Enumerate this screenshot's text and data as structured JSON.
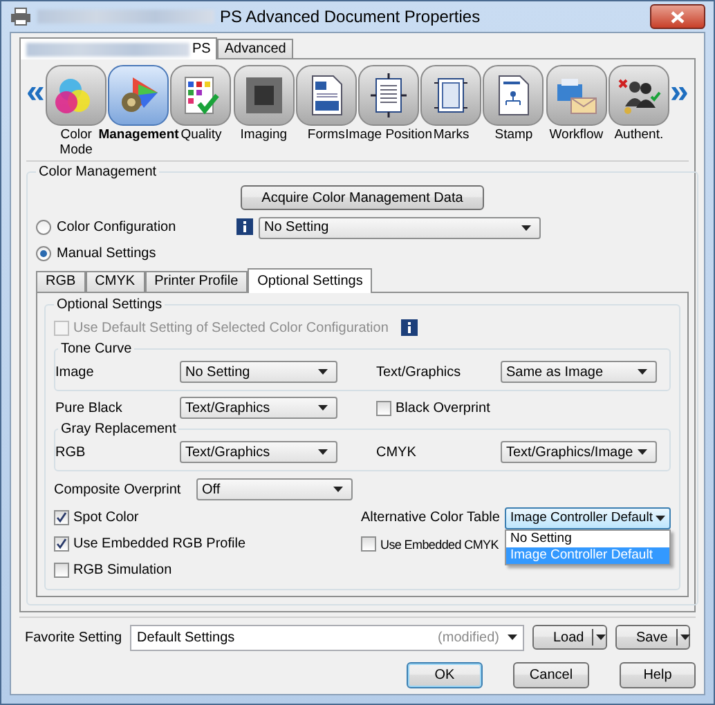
{
  "window": {
    "title": "PS Advanced Document Properties"
  },
  "tabs": [
    {
      "label": "PS",
      "selected": true,
      "redacted": true
    },
    {
      "label": "Advanced",
      "selected": false,
      "redacted": false
    }
  ],
  "category_bar": {
    "prev": "«",
    "next": "»",
    "items": [
      {
        "label": "Color Mode",
        "kind": "color-mode",
        "selected": false
      },
      {
        "label": "Management",
        "kind": "management",
        "selected": true
      },
      {
        "label": "Quality",
        "kind": "quality",
        "selected": false
      },
      {
        "label": "Imaging",
        "kind": "imaging",
        "selected": false
      },
      {
        "label": "Forms",
        "kind": "forms",
        "selected": false
      },
      {
        "label": "Image Position",
        "kind": "image-position",
        "selected": false
      },
      {
        "label": "Marks",
        "kind": "marks",
        "selected": false
      },
      {
        "label": "Stamp",
        "kind": "stamp",
        "selected": false
      },
      {
        "label": "Workflow",
        "kind": "workflow",
        "selected": false
      },
      {
        "label": "Authent.",
        "kind": "authent",
        "selected": false
      }
    ]
  },
  "color_management": {
    "title": "Color Management",
    "acquire_button": "Acquire Color Management Data",
    "modes": [
      {
        "label": "Color Configuration",
        "selected": false
      },
      {
        "label": "Manual Settings",
        "selected": true
      }
    ],
    "configuration_select": {
      "value": "No Setting"
    },
    "tabs": [
      {
        "label": "RGB",
        "selected": false
      },
      {
        "label": "CMYK",
        "selected": false
      },
      {
        "label": "Printer Profile",
        "selected": false
      },
      {
        "label": "Optional Settings",
        "selected": true
      }
    ],
    "optional_settings": {
      "title": "Optional Settings",
      "use_default": {
        "label": "Use Default Setting of Selected Color Configuration",
        "checked": false,
        "disabled": true
      },
      "tone_curve": {
        "title": "Tone Curve",
        "image": {
          "label": "Image",
          "value": "No Setting"
        },
        "text_graphics": {
          "label": "Text/Graphics",
          "value": "Same as Image"
        }
      },
      "pure_black": {
        "label": "Pure Black",
        "value": "Text/Graphics"
      },
      "black_overprint": {
        "label": "Black Overprint",
        "checked": false
      },
      "gray_replacement": {
        "title": "Gray Replacement",
        "rgb": {
          "label": "RGB",
          "value": "Text/Graphics"
        },
        "cmyk": {
          "label": "CMYK",
          "value": "Text/Graphics/Image"
        }
      },
      "composite_overprint": {
        "label": "Composite Overprint",
        "value": "Off"
      },
      "spot_color": {
        "label": "Spot Color",
        "checked": true
      },
      "alternative_color_table": {
        "label": "Alternative Color Table",
        "value": "Image Controller Default",
        "expanded": true,
        "options": [
          {
            "label": "No Setting",
            "selected": false
          },
          {
            "label": "Image Controller Default",
            "selected": true
          }
        ]
      },
      "use_embedded_rgb": {
        "label": "Use Embedded RGB Profile",
        "checked": true
      },
      "use_embedded_cmyk": {
        "label": "Use Embedded CMYK",
        "checked": false
      },
      "rgb_simulation": {
        "label": "RGB Simulation",
        "checked": false
      }
    }
  },
  "favorite": {
    "label": "Favorite Setting",
    "value": "Default Settings",
    "status": "(modified)",
    "load": "Load",
    "save": "Save"
  },
  "buttons": [
    {
      "label": "OK",
      "default": true
    },
    {
      "label": "Cancel",
      "default": false
    },
    {
      "label": "Help",
      "default": false
    }
  ]
}
